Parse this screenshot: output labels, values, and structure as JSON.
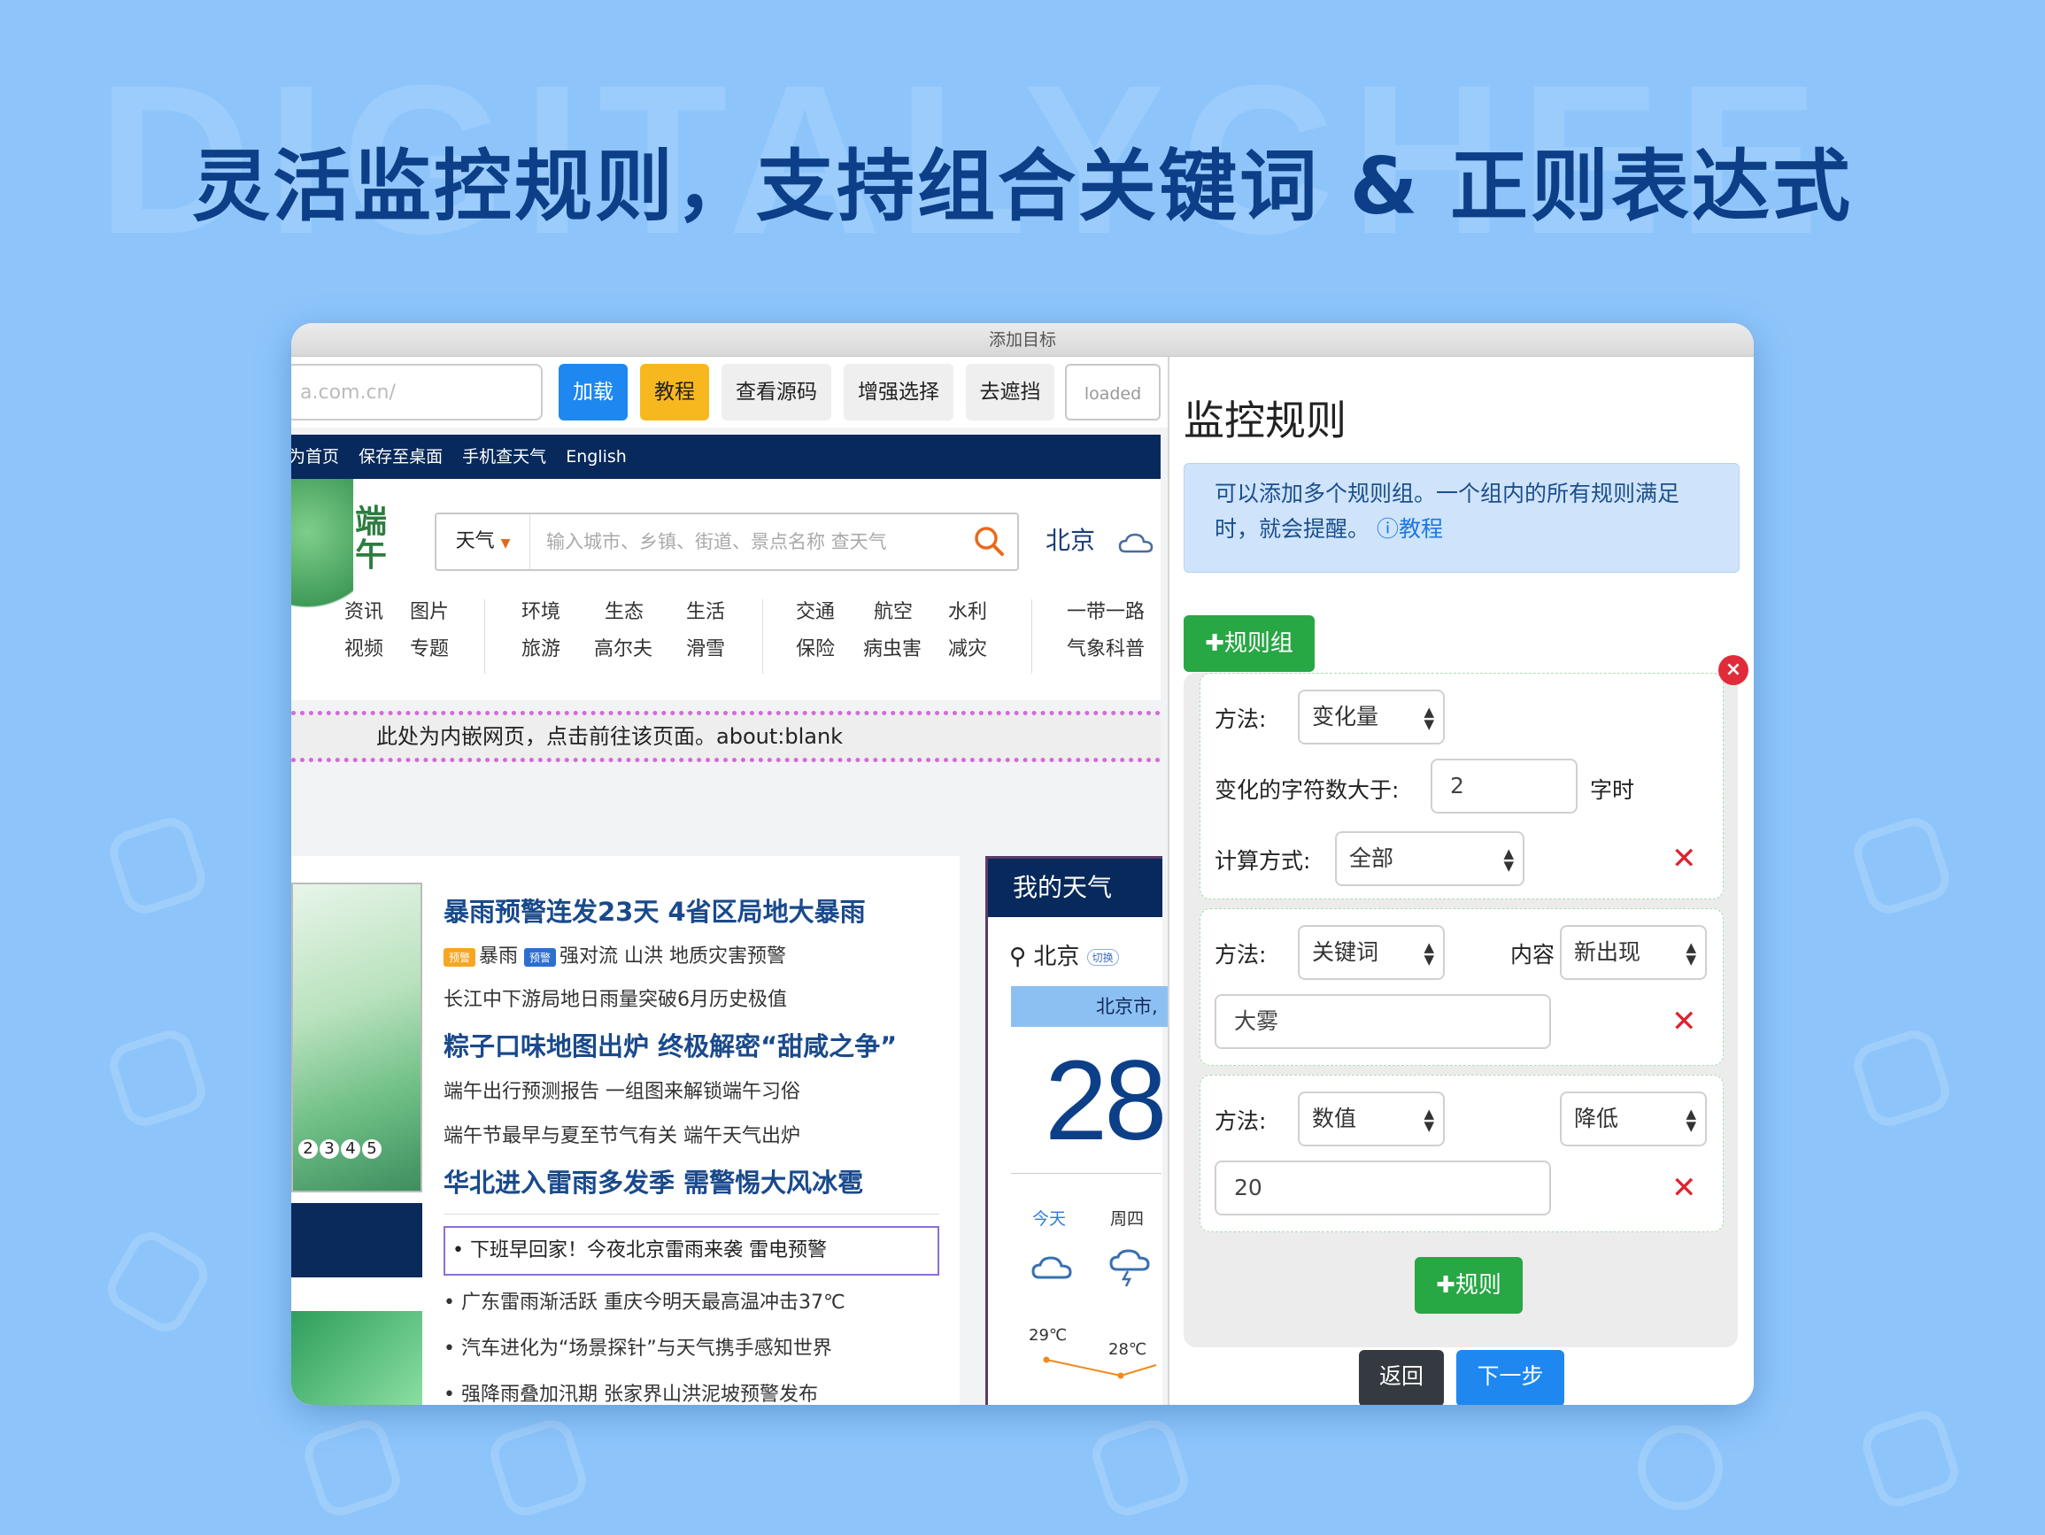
{
  "banner": {
    "watermark": "DIGITALYCHEE",
    "headline": "灵活监控规则，支持组合关键词 & 正则表达式"
  },
  "window": {
    "title": "添加目标"
  },
  "toolbar": {
    "url_value": "a.com.cn/",
    "load_label": "加载",
    "tutorial_label": "教程",
    "view_source_label": "查看源码",
    "enhance_select_label": "增强选择",
    "remove_mask_label": "去遮挡",
    "status_label": "loaded"
  },
  "site": {
    "top_links": [
      "设为首页",
      "保存至桌面",
      "手机查天气",
      "English"
    ],
    "logo_text": "端午",
    "search_select": "天气",
    "search_placeholder": "输入城市、乡镇、街道、景点名称 查天气",
    "city": "北京",
    "categories": [
      [
        "资讯",
        "图片",
        "视频",
        "专题"
      ],
      [
        "环境",
        "生态",
        "生活",
        "旅游",
        "高尔夫",
        "滑雪"
      ],
      [
        "交通",
        "航空",
        "水利",
        "保险",
        "病虫害",
        "减灾"
      ],
      [
        "一带一路",
        "气象科普"
      ]
    ],
    "iframe_note": "此处为内嵌网页，点击前往该页面。about:blank",
    "map_pages": [
      "2",
      "3",
      "4",
      "5"
    ],
    "news": {
      "headline1": "暴雨预警连发23天 4省区局地大暴雨",
      "tag1": "预警",
      "item1": "暴雨",
      "tag2": "预警",
      "item2": "强对流 山洪 地质灾害预警",
      "line2": "长江中下游局地日雨量突破6月历史极值",
      "headline2": "粽子口味地图出炉 终极解密“甜咸之争”",
      "line3": "端午出行预测报告 一组图来解锁端午习俗",
      "line4": "端午节最早与夏至节气有关 端午天气出炉",
      "headline3": "华北进入雷雨多发季 需警惕大风冰雹",
      "alert": "下班早回家！今夜北京雷雨来袭  雷电预警",
      "bullet1": "广东雷雨渐活跃  重庆今明天最高温冲击37℃",
      "bullet2": "汽车进化为“场景探针”与天气携手感知世界",
      "bullet3": "强降雨叠加汛期 张家界山洪泥坡预警发布"
    },
    "weather": {
      "title": "我的天气",
      "city": "北京",
      "switch": "切换",
      "bar_text": "北京市,",
      "temp": "28",
      "day1": "今天",
      "day2": "周四",
      "t1": "29℃",
      "t2": "28℃"
    }
  },
  "panel": {
    "title": "监控规则",
    "info_text": "可以添加多个规则组。一个组内的所有规则满足时，就会提醒。",
    "info_link": "ⓘ教程",
    "add_group_label": "✚规则组",
    "close_group": "×",
    "rules": [
      {
        "method_label": "方法:",
        "method": "变化量",
        "threshold_label": "变化的字符数大于:",
        "threshold": "2",
        "threshold_suffix": "字时",
        "calc_label": "计算方式:",
        "calc": "全部"
      },
      {
        "method_label": "方法:",
        "method": "关键词",
        "content_label": "内容",
        "content_mode": "新出现",
        "keyword": "大雾"
      },
      {
        "method_label": "方法:",
        "method": "数值",
        "direction": "降低",
        "value": "20"
      }
    ],
    "delete_icon": "✕",
    "add_rule_label": "✚规则",
    "back_label": "返回",
    "next_label": "下一步"
  },
  "colors": {
    "background": "#8dc5fb",
    "headline": "#0c3f88",
    "primary": "#1e87f0",
    "success": "#28a745",
    "danger": "#e0222e",
    "warning": "#f6b81e",
    "site_nav": "#07295b"
  }
}
